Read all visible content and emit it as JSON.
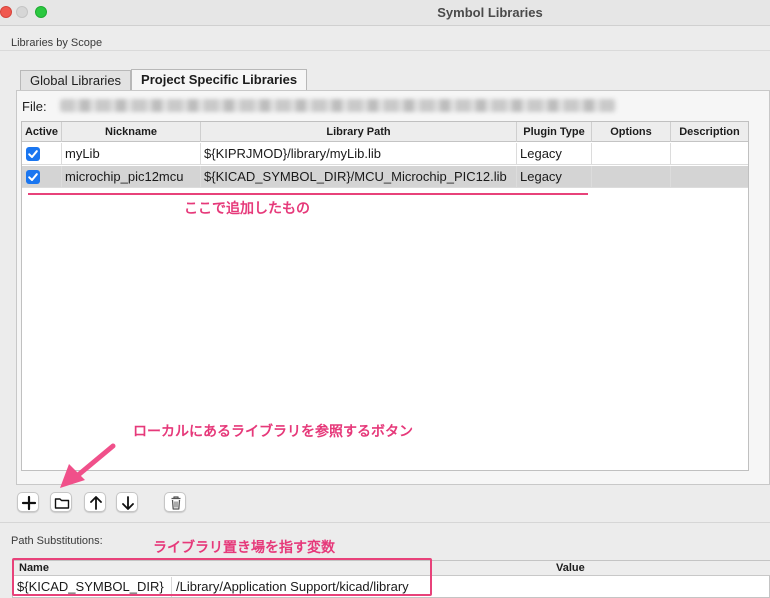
{
  "window": {
    "title": "Symbol Libraries"
  },
  "scope": {
    "label": "Libraries by Scope"
  },
  "tabs": [
    {
      "label": "Global Libraries",
      "active": false
    },
    {
      "label": "Project Specific Libraries",
      "active": true
    }
  ],
  "file": {
    "label": "File:"
  },
  "table": {
    "headers": [
      "Active",
      "Nickname",
      "Library Path",
      "Plugin Type",
      "Options",
      "Description"
    ],
    "rows": [
      {
        "active": true,
        "nickname": "myLib",
        "path": "${KIPRJMOD}/library/myLib.lib",
        "plugin": "Legacy",
        "options": "",
        "description": ""
      },
      {
        "active": true,
        "nickname": "microchip_pic12mcu",
        "path": "${KICAD_SYMBOL_DIR}/MCU_Microchip_PIC12.lib",
        "plugin": "Legacy",
        "options": "",
        "description": ""
      }
    ]
  },
  "annotations": {
    "added": "ここで追加したもの",
    "browse": "ローカルにあるライブラリを参照するボタン",
    "pathvar": "ライブラリ置き場を指す変数"
  },
  "toolbar": {
    "add_icon": "plus-icon",
    "browse_icon": "folder-icon",
    "up_icon": "arrow-up-icon",
    "down_icon": "arrow-down-icon",
    "delete_icon": "trash-icon"
  },
  "path_subst": {
    "label": "Path Substitutions:",
    "headers": [
      "Name",
      "Value"
    ],
    "rows": [
      {
        "name": "${KICAD_SYMBOL_DIR}",
        "value": "/Library/Application Support/kicad/library"
      }
    ]
  },
  "colors": {
    "annotation": "#e6397a",
    "checkbox": "#1a76f0",
    "selected_row": "#d4d4d4"
  }
}
